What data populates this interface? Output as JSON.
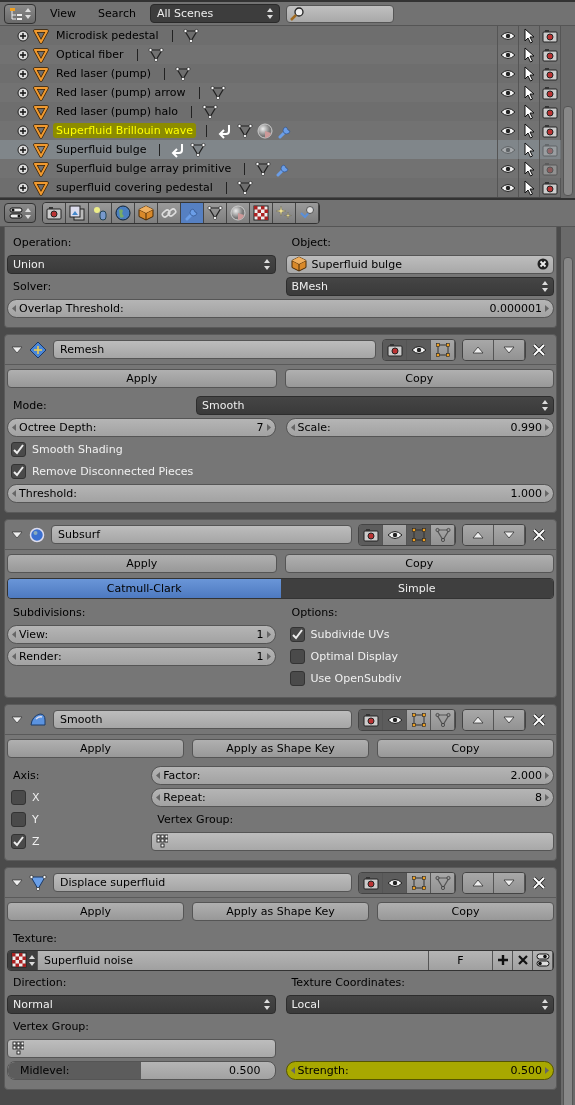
{
  "outliner": {
    "menus": [
      "View",
      "Search"
    ],
    "scene": "All Scenes",
    "rows": [
      {
        "name": "Microdisk pedestal",
        "highlighted": false,
        "selected": false,
        "visible": true,
        "renderable": true,
        "icons": [
          {
            "kind": "mesh"
          }
        ]
      },
      {
        "name": "Optical fiber",
        "highlighted": false,
        "selected": false,
        "visible": true,
        "renderable": true,
        "icons": [
          {
            "kind": "mesh"
          }
        ]
      },
      {
        "name": "Red laser (pump)",
        "highlighted": false,
        "selected": false,
        "visible": true,
        "renderable": true,
        "icons": [
          {
            "kind": "mesh"
          }
        ]
      },
      {
        "name": "Red laser (pump) arrow",
        "highlighted": false,
        "selected": false,
        "visible": true,
        "renderable": true,
        "icons": [
          {
            "kind": "mesh"
          }
        ]
      },
      {
        "name": "Red laser (pump) halo",
        "highlighted": false,
        "selected": false,
        "visible": true,
        "renderable": true,
        "icons": [
          {
            "kind": "mesh"
          }
        ]
      },
      {
        "name": "Superfluid Brillouin wave",
        "highlighted": true,
        "selected": false,
        "visible": true,
        "renderable": true,
        "icons": [
          {
            "kind": "link"
          },
          {
            "kind": "mesh"
          },
          {
            "kind": "material"
          },
          {
            "kind": "wrench"
          }
        ]
      },
      {
        "name": "Superfluid bulge",
        "highlighted": false,
        "selected": true,
        "visible": false,
        "renderable": false,
        "icons": [
          {
            "kind": "link"
          },
          {
            "kind": "mesh"
          }
        ]
      },
      {
        "name": "Superfluid bulge array primitive",
        "highlighted": false,
        "selected": false,
        "visible": true,
        "renderable": false,
        "icons": [
          {
            "kind": "mesh"
          },
          {
            "kind": "wrench"
          }
        ]
      },
      {
        "name": "superfluid covering pedestal",
        "highlighted": false,
        "selected": false,
        "visible": true,
        "renderable": true,
        "icons": [
          {
            "kind": "mesh"
          }
        ]
      }
    ]
  },
  "properties": {
    "tabs": [
      {
        "kind": "render",
        "selected": false
      },
      {
        "kind": "render_layers",
        "selected": false
      },
      {
        "kind": "scene",
        "selected": false
      },
      {
        "kind": "world",
        "selected": false
      },
      {
        "kind": "object",
        "selected": false
      },
      {
        "kind": "constraints",
        "selected": false
      },
      {
        "kind": "modifiers",
        "selected": true
      },
      {
        "kind": "data",
        "selected": false
      },
      {
        "kind": "material",
        "selected": false
      },
      {
        "kind": "texture",
        "selected": false
      },
      {
        "kind": "particles",
        "selected": false
      },
      {
        "kind": "physics",
        "selected": false
      }
    ],
    "partial_panel": {
      "rows": [
        {
          "kind": "columns",
          "columns": [
            [
              {
                "kind": "label",
                "text": "Operation:"
              },
              {
                "kind": "dropdown",
                "value": "Union"
              },
              {
                "kind": "label",
                "text": "Solver:"
              }
            ],
            [
              {
                "kind": "label",
                "text": "Object:"
              },
              {
                "kind": "object",
                "value": "Superfluid bulge"
              },
              {
                "kind": "dropdown",
                "value": "BMesh"
              }
            ]
          ]
        },
        {
          "kind": "numbers",
          "items": [
            {
              "label": "Overlap Threshold:",
              "value": "0.000001"
            }
          ]
        }
      ]
    },
    "modifiers": [
      {
        "kind": "remesh",
        "name": "Remesh",
        "toggles": [
          {
            "kind": "render",
            "on": true
          },
          {
            "kind": "realtime",
            "on": true
          },
          {
            "kind": "editmode",
            "on": false
          }
        ],
        "rows": [
          {
            "kind": "buttons",
            "items": [
              "Apply",
              "Copy"
            ]
          },
          {
            "kind": "label_dropdown",
            "label": "Mode:",
            "value": "Smooth"
          },
          {
            "kind": "numbers",
            "items": [
              {
                "label": "Octree Depth:",
                "value": "7"
              },
              {
                "label": "Scale:",
                "value": "0.990"
              }
            ]
          },
          {
            "kind": "checkbox",
            "label": "Smooth Shading",
            "checked": true
          },
          {
            "kind": "checkbox",
            "label": "Remove Disconnected Pieces",
            "checked": true
          },
          {
            "kind": "numbers",
            "items": [
              {
                "label": "Threshold:",
                "value": "1.000"
              }
            ]
          }
        ]
      },
      {
        "kind": "subsurf",
        "name": "Subsurf",
        "toggles": [
          {
            "kind": "render",
            "on": true
          },
          {
            "kind": "realtime",
            "on": false
          },
          {
            "kind": "editmode",
            "on": true
          },
          {
            "kind": "cage",
            "on": false
          }
        ],
        "rows": [
          {
            "kind": "buttons",
            "items": [
              "Apply",
              "Copy"
            ]
          },
          {
            "kind": "segmented",
            "options": [
              {
                "label": "Catmull-Clark",
                "selected": true
              },
              {
                "label": "Simple",
                "selected": false
              }
            ]
          },
          {
            "kind": "columns",
            "columns": [
              [
                {
                  "kind": "label",
                  "text": "Subdivisions:"
                },
                {
                  "kind": "number",
                  "label": "View:",
                  "value": "1"
                },
                {
                  "kind": "number",
                  "label": "Render:",
                  "value": "1"
                }
              ],
              [
                {
                  "kind": "label",
                  "text": "Options:"
                },
                {
                  "kind": "checkbox",
                  "label": "Subdivide UVs",
                  "checked": true
                },
                {
                  "kind": "checkbox",
                  "label": "Optimal Display",
                  "checked": false
                },
                {
                  "kind": "checkbox",
                  "label": "Use OpenSubdiv",
                  "checked": false
                }
              ]
            ]
          }
        ]
      },
      {
        "kind": "smooth",
        "name": "Smooth",
        "toggles": [
          {
            "kind": "render",
            "on": true
          },
          {
            "kind": "realtime",
            "on": true
          },
          {
            "kind": "editmode",
            "on": false
          },
          {
            "kind": "cage",
            "on": false
          }
        ],
        "rows": [
          {
            "kind": "buttons",
            "items": [
              "Apply",
              "Apply as Shape Key",
              "Copy"
            ]
          },
          {
            "kind": "narrow_columns",
            "columns": [
              [
                {
                  "kind": "label",
                  "text": "Axis:"
                },
                {
                  "kind": "checkbox",
                  "label": "X",
                  "checked": false
                },
                {
                  "kind": "checkbox",
                  "label": "Y",
                  "checked": false
                },
                {
                  "kind": "checkbox",
                  "label": "Z",
                  "checked": true
                }
              ],
              [
                {
                  "kind": "number",
                  "label": "Factor:",
                  "value": "2.000"
                },
                {
                  "kind": "number",
                  "label": "Repeat:",
                  "value": "8"
                },
                {
                  "kind": "label",
                  "text": "Vertex Group:"
                },
                {
                  "kind": "vertex_group"
                }
              ]
            ]
          }
        ]
      },
      {
        "kind": "displace",
        "name": "Displace superfluid",
        "toggles": [
          {
            "kind": "render",
            "on": true
          },
          {
            "kind": "realtime",
            "on": true
          },
          {
            "kind": "editmode",
            "on": false
          },
          {
            "kind": "cage",
            "on": false
          }
        ],
        "rows": [
          {
            "kind": "buttons",
            "items": [
              "Apply",
              "Apply as Shape Key",
              "Copy"
            ]
          },
          {
            "kind": "label",
            "text": "Texture:"
          },
          {
            "kind": "texture",
            "value": "Superfluid noise",
            "fake_user": "F"
          },
          {
            "kind": "columns",
            "columns": [
              [
                {
                  "kind": "label",
                  "text": "Direction:"
                },
                {
                  "kind": "dropdown",
                  "value": "Normal"
                },
                {
                  "kind": "label",
                  "text": "Vertex Group:"
                },
                {
                  "kind": "vertex_group"
                }
              ],
              [
                {
                  "kind": "label",
                  "text": "Texture Coordinates:"
                },
                {
                  "kind": "dropdown",
                  "value": "Local"
                }
              ]
            ]
          },
          {
            "kind": "columns",
            "columns": [
              [
                {
                  "kind": "slider",
                  "label": "Midlevel:",
                  "value": "0.500",
                  "level": 0.5
                }
              ],
              [
                {
                  "kind": "number",
                  "label": "Strength:",
                  "value": "0.500",
                  "highlighted": true
                }
              ]
            ]
          }
        ]
      }
    ]
  }
}
